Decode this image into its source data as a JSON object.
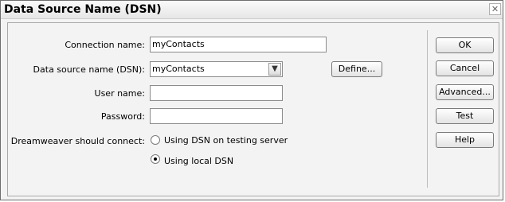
{
  "window": {
    "title": "Data Source Name (DSN)"
  },
  "form": {
    "connection_name_label": "Connection name:",
    "connection_name_value": "myContacts",
    "dsn_label": "Data source name (DSN):",
    "dsn_value": "myContacts",
    "user_label": "User name:",
    "user_value": "",
    "password_label": "Password:",
    "password_value": "",
    "connect_label": "Dreamweaver should connect:",
    "radio_testing_server": "Using DSN on testing server",
    "radio_local": "Using local DSN",
    "selected_radio": "local"
  },
  "buttons": {
    "define": "Define...",
    "ok": "OK",
    "cancel": "Cancel",
    "advanced": "Advanced...",
    "test": "Test",
    "help": "Help"
  },
  "icons": {
    "close": "close-icon",
    "dropdown": "chevron-down-icon"
  }
}
